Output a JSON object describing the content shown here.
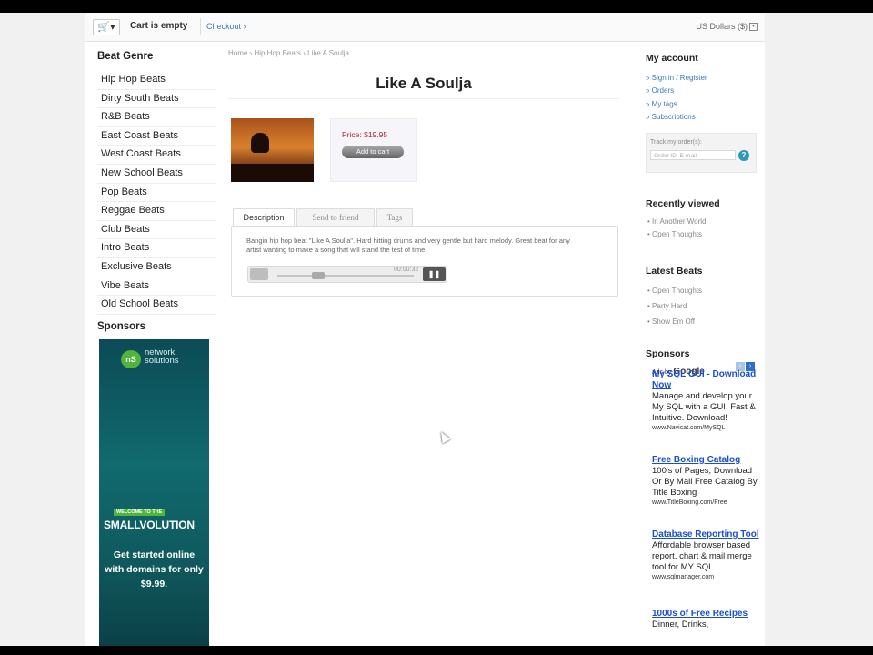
{
  "topbar": {
    "cart_icon": "▾",
    "cart_status": "Cart is empty",
    "checkout": "Checkout ›",
    "currency": "US Dollars ($)"
  },
  "left": {
    "genre_heading": "Beat Genre",
    "genres": [
      "Hip Hop Beats",
      "Dirty South Beats",
      "R&B Beats",
      "East Coast Beats",
      "West Coast Beats",
      "New School Beats",
      "Pop Beats",
      "Reggae Beats",
      "Club Beats",
      "Intro Beats",
      "Exclusive Beats",
      "Vibe Beats",
      "Old School Beats"
    ],
    "sponsors_heading": "Sponsors",
    "banner": {
      "brand_mark": "nS",
      "brand_line1": "network",
      "brand_line2": "solutions",
      "welcome": "WELCOME TO THE",
      "campaign": "SMALLVOLUTION",
      "offer": "Get started online with domains for only $9.99."
    }
  },
  "main": {
    "breadcrumb": "Home › Hip Hop Beats › Like A Soulja",
    "title": "Like A Soulja",
    "price": "Price: $19.95",
    "add_to_cart": "Add to cart",
    "tabs": [
      "Description",
      "Send to friend",
      "Tags"
    ],
    "description": "Bangin hip hop beat \"Like A Soulja\". Hard hitting drums and very gentle but hard melody. Great beat for any artist wanting to make a song that will stand the test of time.",
    "player": {
      "time": "00:00:32",
      "pause_glyph": "❚❚",
      "progress": 0.3
    }
  },
  "right": {
    "account_heading": "My account",
    "account_links": [
      "Sign in / Register",
      "Orders",
      "My tags",
      "Subscriptions"
    ],
    "track_label": "Track my order(s):",
    "track_placeholder": "Order ID, E-mail",
    "track_help": "?",
    "recent_heading": "Recently viewed",
    "recent_items": [
      "In Another World",
      "Open Thoughts"
    ],
    "latest_heading": "Latest Beats",
    "latest_items": [
      "Open Thoughts",
      "Party Hard",
      "Show Em Off"
    ],
    "sponsors_heading": "Sponsors",
    "ads_by": "Ads by",
    "ads_brand": "Google",
    "ads": [
      {
        "title": "My SQL GUI - Download Now",
        "body": "Manage and develop your My SQL with a GUI. Fast & Intuitive. Download!",
        "url": "www.Navicat.com/MySQL"
      },
      {
        "title": "Free Boxing Catalog",
        "body": "100's of Pages, Download Or By Mail Free Catalog By Title Boxing",
        "url": "www.TitleBoxing.com/Free"
      },
      {
        "title": "Database Reporting Tool",
        "body": "Affordable browser based report, chart & mail merge tool for MY SQL",
        "url": "www.sqlmanager.com"
      },
      {
        "title": "1000s of Free Recipes",
        "body": "Dinner, Drinks,",
        "url": ""
      }
    ]
  }
}
